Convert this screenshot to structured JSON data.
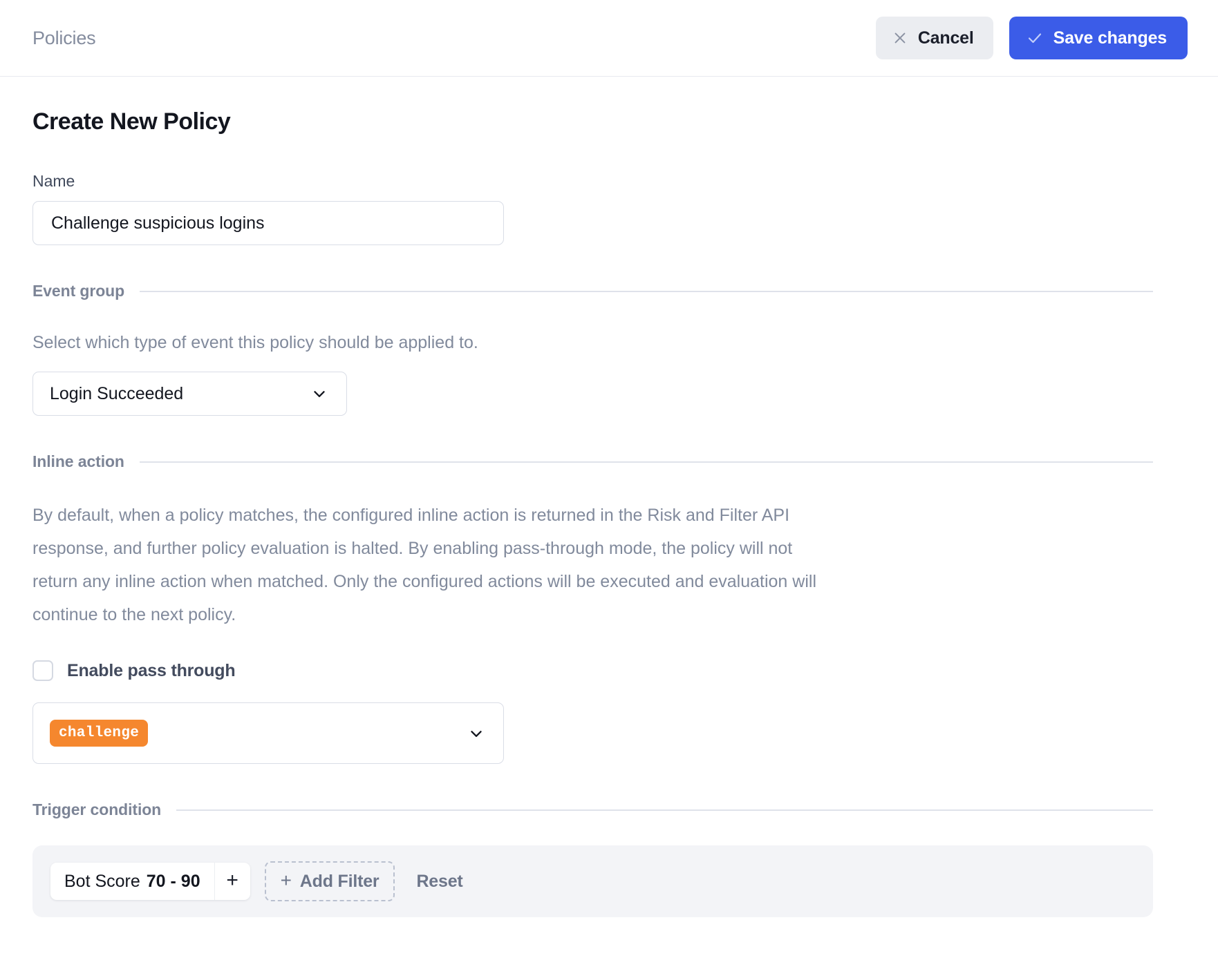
{
  "topbar": {
    "breadcrumb": "Policies",
    "cancel_label": "Cancel",
    "save_label": "Save changes",
    "cancel_icon": "close-icon",
    "save_icon": "check-icon",
    "save_bg": "#3b5ce8",
    "cancel_bg": "#ebedf1"
  },
  "page": {
    "title": "Create New Policy"
  },
  "name_field": {
    "label": "Name",
    "value": "Challenge suspicious logins",
    "placeholder": "Policy name"
  },
  "event_group": {
    "section_title": "Event group",
    "helper": "Select which type of event this policy should be applied to.",
    "selected": "Login Succeeded",
    "chevron_icon": "chevron-down-icon"
  },
  "inline_action": {
    "section_title": "Inline action",
    "description": "By default, when a policy matches, the configured inline action is returned in the Risk and Filter API response, and further policy evaluation is halted. By enabling pass-through mode, the policy will not return any inline action when matched. Only the configured actions will be executed and evaluation will continue to the next policy.",
    "checkbox_label": "Enable pass through",
    "checkbox_checked": false,
    "selected_tag": "challenge",
    "tag_color": "#f5872e",
    "chevron_icon": "chevron-down-icon"
  },
  "trigger_condition": {
    "section_title": "Trigger condition",
    "filter_chip": {
      "field": "Bot Score",
      "value": "70 - 90",
      "add_symbol": "+"
    },
    "add_filter_label": "Add Filter",
    "add_filter_symbol": "+",
    "reset_label": "Reset"
  }
}
